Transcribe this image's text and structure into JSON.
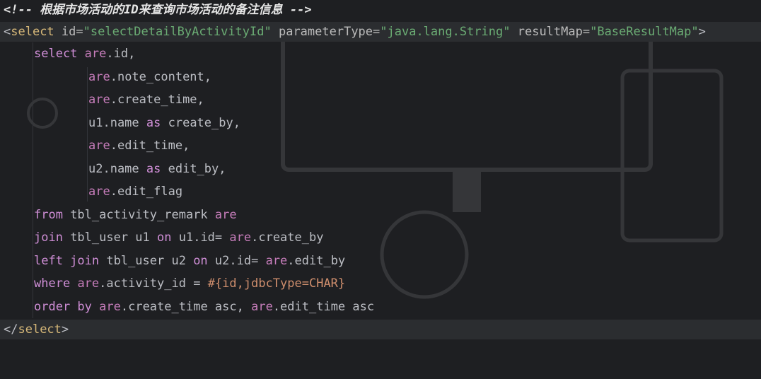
{
  "editor": {
    "comment": "<!-- 根据市场活动的ID来查询市场活动的备注信息 -->",
    "select_open": {
      "lt": "<",
      "tag": "select",
      "id_attr": " id=",
      "id_val": "\"selectDetailByActivityId\"",
      "param_attr": " parameterType=",
      "param_val": "\"java.lang.String\"",
      "result_attr": " resultMap=",
      "result_val": "\"BaseResultMap\"",
      "gt": ">"
    },
    "sql": {
      "l1_kw": "select",
      "l1_alias": "are",
      "l1_rest": ".id,",
      "l2_alias": "are",
      "l2_rest": ".note_content,",
      "l3_alias": "are",
      "l3_rest": ".create_time,",
      "l4_a": "u1.name ",
      "l4_kw": "as",
      "l4_b": " create_by,",
      "l5_alias": "are",
      "l5_rest": ".edit_time,",
      "l6_a": "u2.name ",
      "l6_kw": "as",
      "l6_b": " edit_by,",
      "l7_alias": "are",
      "l7_rest": ".edit_flag",
      "l8_kw": "from",
      "l8_a": " tbl_activity_remark ",
      "l8_alias": "are",
      "l9_kw": "join",
      "l9_a": " tbl_user u1 ",
      "l9_kw2": "on",
      "l9_b": " u1.id= ",
      "l9_alias": "are",
      "l9_c": ".create_by",
      "l10_kw": "left join",
      "l10_a": " tbl_user u2 ",
      "l10_kw2": "on",
      "l10_b": " u2.id= ",
      "l10_alias": "are",
      "l10_c": ".edit_by",
      "l11_kw": "where",
      "l11_sp": " ",
      "l11_alias": "are",
      "l11_a": ".activity_id = ",
      "l11_param": "#{id,jdbcType=CHAR}",
      "l12_kw": "order by",
      "l12_sp": " ",
      "l12_alias": "are",
      "l12_a": ".create_time asc, ",
      "l12_alias2": "are",
      "l12_b": ".edit_time asc"
    },
    "select_close": {
      "lt": "</",
      "tag": "select",
      "gt": ">"
    }
  },
  "colors": {
    "background": "#1e1f22",
    "tag": "#d5b778",
    "string": "#6aab73",
    "keyword": "#cf8ed6",
    "comment": "#e6e6e6"
  }
}
